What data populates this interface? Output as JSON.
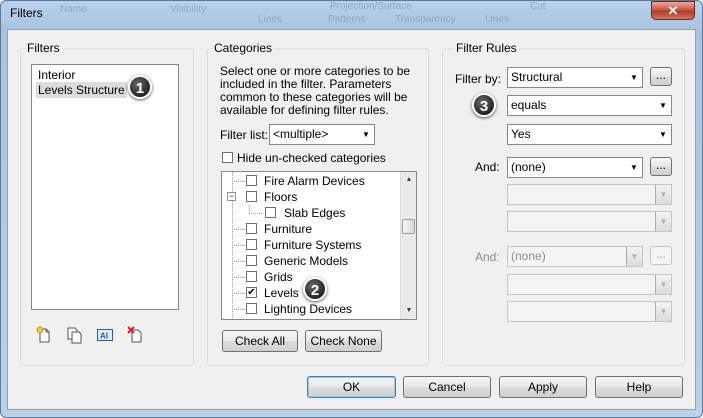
{
  "window": {
    "title": "Filters",
    "background_ghost_text": [
      "Name",
      "Visibility",
      "Projection/Surface",
      "Cut",
      "Lines",
      "Patterns",
      "Transparency",
      "Lines"
    ],
    "close_glyph": "✕"
  },
  "filters_panel": {
    "label": "Filters",
    "items": [
      "Interior",
      "Levels Structure"
    ],
    "selected_index": 1,
    "icons": [
      "new-filter-icon",
      "duplicate-filter-icon",
      "rename-filter-icon",
      "delete-filter-icon"
    ]
  },
  "categories_panel": {
    "label": "Categories",
    "instructions": "Select one or more categories to be included in the filter.  Parameters common to these categories will be available for defining filter rules.",
    "filter_list_label": "Filter list:",
    "filter_list_value": "<multiple>",
    "hide_unchecked_label": "Hide un-checked categories",
    "hide_unchecked_checked": false,
    "tree_items": [
      {
        "label": "Fire Alarm Devices",
        "checked": false
      },
      {
        "label": "Floors",
        "checked": false,
        "expanded": true
      },
      {
        "label": "Slab Edges",
        "checked": false
      },
      {
        "label": "Furniture",
        "checked": false
      },
      {
        "label": "Furniture Systems",
        "checked": false
      },
      {
        "label": "Generic Models",
        "checked": false
      },
      {
        "label": "Grids",
        "checked": false
      },
      {
        "label": "Levels",
        "checked": true
      },
      {
        "label": "Lighting Devices",
        "checked": false
      }
    ],
    "check_all_label": "Check All",
    "check_none_label": "Check None"
  },
  "filter_rules_panel": {
    "label": "Filter Rules",
    "filter_by_label": "Filter by:",
    "filter_by_value": "Structural",
    "operator_value": "equals",
    "value_value": "Yes",
    "and1_label": "And:",
    "and1_value": "(none)",
    "and2_label": "And:",
    "and2_value": "(none)",
    "ellipsis_label": "..."
  },
  "callouts": [
    "1",
    "2",
    "3"
  ],
  "buttons": {
    "ok": "OK",
    "cancel": "Cancel",
    "apply": "Apply",
    "help": "Help"
  },
  "colors": {
    "title_bar": "#b9d1ea",
    "close_button": "#c4523d",
    "dialog_background": "#f0f0f0",
    "default_button_border": "#3c7fb1"
  }
}
